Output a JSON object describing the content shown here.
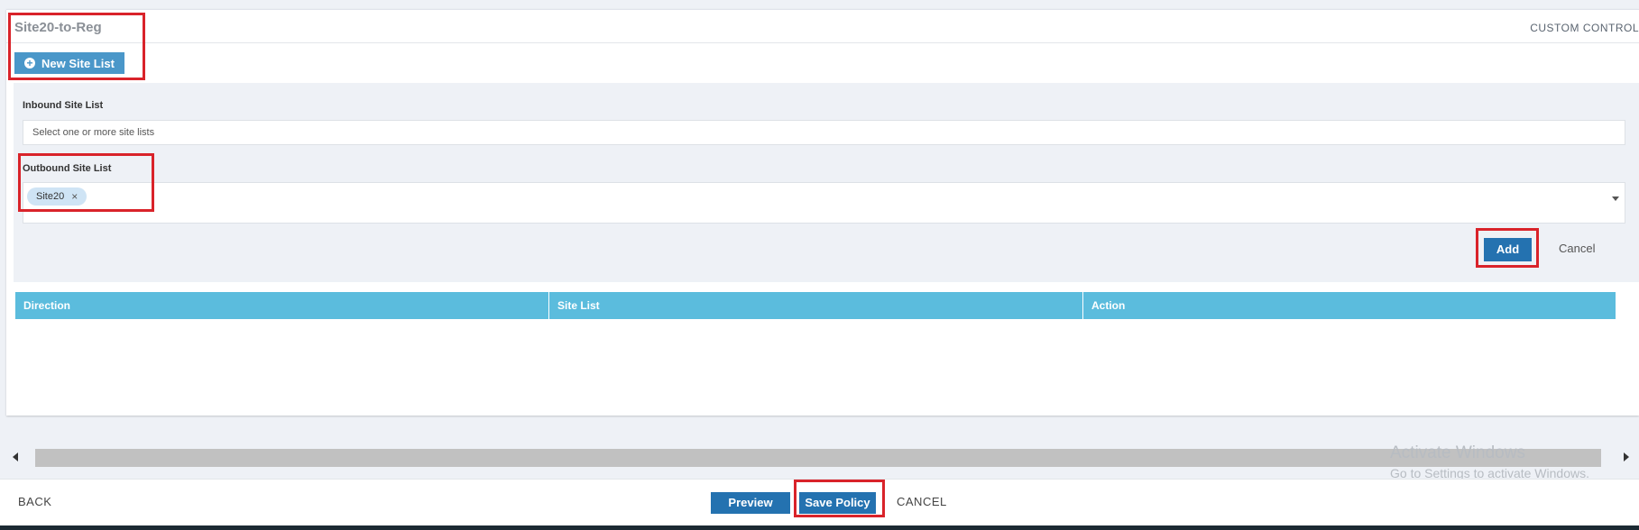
{
  "policy": {
    "title": "Site20-to-Reg",
    "custom_control": "CUSTOM CONTROL",
    "new_site_list_label": "New Site List"
  },
  "form": {
    "inbound_label": "Inbound Site List",
    "inbound_placeholder": "Select one or more site lists",
    "outbound_label": "Outbound Site List",
    "outbound_selected": [
      "Site20"
    ],
    "add_label": "Add",
    "cancel_label": "Cancel"
  },
  "table": {
    "columns": [
      "Direction",
      "Site List",
      "Action"
    ],
    "rows": []
  },
  "footer": {
    "back_label": "BACK",
    "preview_label": "Preview",
    "save_label": "Save Policy",
    "cancel_label": "CANCEL"
  },
  "watermark": {
    "title": "Activate Windows",
    "subtitle": "Go to Settings to activate Windows."
  },
  "colors": {
    "primary_button": "#2472b0",
    "new_button": "#4a97c9",
    "table_header": "#5bbcdd",
    "highlight_box": "#d9232a"
  }
}
